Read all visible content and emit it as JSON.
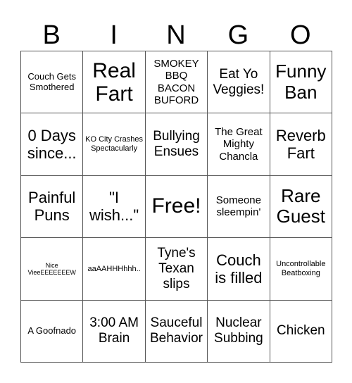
{
  "header": [
    "B",
    "I",
    "N",
    "G",
    "O"
  ],
  "cells": [
    {
      "text": "Couch Gets Smothered",
      "size": "s-13"
    },
    {
      "text": "Real Fart",
      "size": "s-big"
    },
    {
      "text": "SMOKEY BBQ BACON BUFORD",
      "size": "s-md"
    },
    {
      "text": "Eat Yo Veggies!",
      "size": "s-lg"
    },
    {
      "text": "Funny Ban",
      "size": "s-xxl"
    },
    {
      "text": "0 Days since...",
      "size": "s-xl"
    },
    {
      "text": "KO City Crashes Spectacularly",
      "size": "s-sm"
    },
    {
      "text": "Bullying Ensues",
      "size": "s-lg"
    },
    {
      "text": "The Great Mighty Chancla",
      "size": "s-md"
    },
    {
      "text": "Reverb Fart",
      "size": "s-xl"
    },
    {
      "text": "Painful Puns",
      "size": "s-xl"
    },
    {
      "text": "\"I wish...\"",
      "size": "s-xl"
    },
    {
      "text": "Free!",
      "size": "s-free"
    },
    {
      "text": "Someone sleempin'",
      "size": "s-md"
    },
    {
      "text": "Rare Guest",
      "size": "s-xxl"
    },
    {
      "text": "Nice VieeEEEEEEEW",
      "size": "s-xs"
    },
    {
      "text": "aaAAHHHhhh..",
      "size": "s-sm"
    },
    {
      "text": "Tyne's Texan slips",
      "size": "s-lg"
    },
    {
      "text": "Couch is filled",
      "size": "s-xl"
    },
    {
      "text": "Uncontrollable Beatboxing",
      "size": "s-sm"
    },
    {
      "text": "A Goofnado",
      "size": "s-13"
    },
    {
      "text": "3:00 AM Brain",
      "size": "s-lg"
    },
    {
      "text": "Sauceful Behavior",
      "size": "s-lg"
    },
    {
      "text": "Nuclear Subbing",
      "size": "s-lg"
    },
    {
      "text": "Chicken",
      "size": "s-lg"
    }
  ]
}
